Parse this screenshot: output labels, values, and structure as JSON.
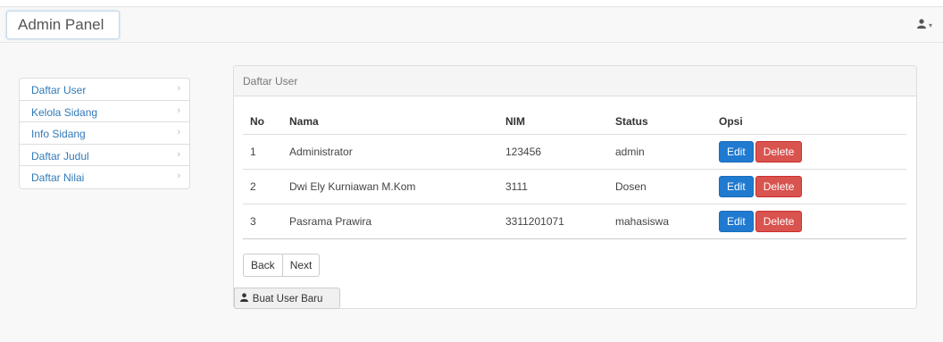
{
  "navbar": {
    "brand": "Admin Panel",
    "user_icon": "user-icon"
  },
  "sidebar": {
    "items": [
      {
        "label": "Daftar User"
      },
      {
        "label": "Kelola Sidang"
      },
      {
        "label": "Info Sidang"
      },
      {
        "label": "Daftar Judul"
      },
      {
        "label": "Daftar Nilai"
      }
    ],
    "chevron": "›"
  },
  "panel": {
    "title": "Daftar User",
    "columns": [
      "No",
      "Nama",
      "NIM",
      "Status",
      "Opsi"
    ],
    "rows": [
      {
        "no": "1",
        "nama": "Administrator",
        "nim": "123456",
        "status": "admin"
      },
      {
        "no": "2",
        "nama": "Dwi Ely Kurniawan M.Kom",
        "nim": "3111",
        "status": "Dosen"
      },
      {
        "no": "3",
        "nama": "Pasrama Prawira",
        "nim": "3311201071",
        "status": "mahasiswa"
      }
    ],
    "edit_label": "Edit",
    "delete_label": "Delete",
    "back_label": "Back",
    "next_label": "Next",
    "new_user_label": "Buat User Baru"
  },
  "colors": {
    "accent": "#337ab7",
    "edit": "#1f7ad0",
    "delete": "#d9534f"
  }
}
